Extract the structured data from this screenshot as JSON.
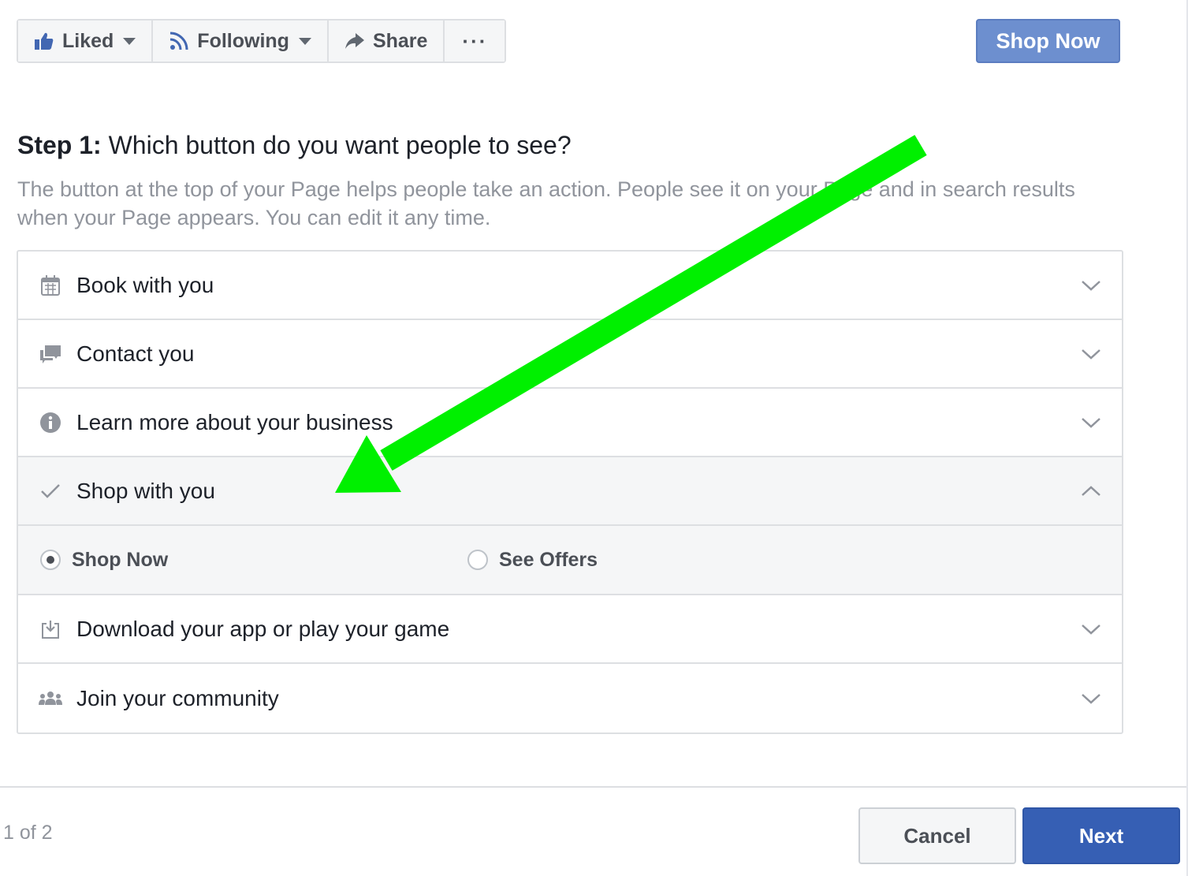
{
  "action_bar": {
    "liked_label": "Liked",
    "following_label": "Following",
    "share_label": "Share",
    "more_label": "···"
  },
  "preview_button_label": "Shop Now",
  "step": {
    "prefix": "Step 1:",
    "question": "Which button do you want people to see?",
    "description": "The button at the top of your Page helps people take an action. People see it on your Page and in search results when your Page appears. You can edit it any time."
  },
  "options": [
    {
      "label": "Book with you",
      "icon": "calendar-icon",
      "expanded": false
    },
    {
      "label": "Contact you",
      "icon": "chat-bubbles-icon",
      "expanded": false
    },
    {
      "label": "Learn more about your business",
      "icon": "info-icon",
      "expanded": false
    },
    {
      "label": "Shop with you",
      "icon": "checkmark-icon",
      "expanded": true
    },
    {
      "label": "Download your app or play your game",
      "icon": "download-icon",
      "expanded": false
    },
    {
      "label": "Join your community",
      "icon": "people-icon",
      "expanded": false
    }
  ],
  "shop_suboptions": [
    {
      "label": "Shop Now",
      "selected": true
    },
    {
      "label": "See Offers",
      "selected": false
    }
  ],
  "footer": {
    "pager": "1 of 2",
    "cancel_label": "Cancel",
    "next_label": "Next"
  },
  "colors": {
    "brand_blue": "#365fb4",
    "preview_blue": "#6d8fcf",
    "annotation_green": "#00f000"
  }
}
